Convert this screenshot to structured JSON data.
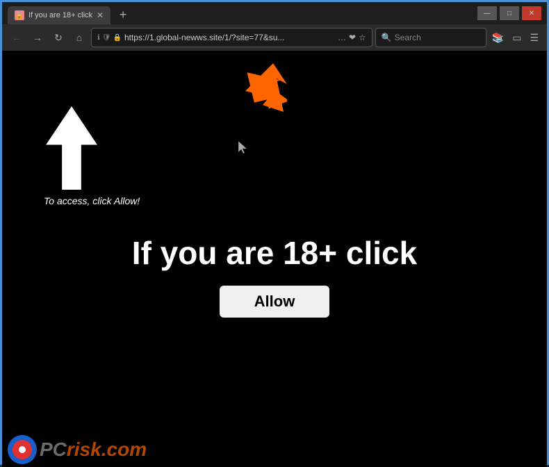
{
  "window": {
    "border_color": "#4a90d9"
  },
  "titlebar": {
    "tab": {
      "label": "If you are 18+ click",
      "favicon_text": "🔒"
    },
    "new_tab_label": "+",
    "controls": {
      "minimize": "—",
      "maximize": "□",
      "close": "✕"
    }
  },
  "navbar": {
    "back_icon": "←",
    "forward_icon": "→",
    "refresh_icon": "↻",
    "home_icon": "⌂",
    "address": {
      "url": "https://1.global-newws.site/1/?site=77&su...",
      "lock_icon": "🔒",
      "info_icon": "ℹ",
      "shield_icon": "🛡",
      "star_icon": "☆",
      "more_icon": "…"
    },
    "search": {
      "placeholder": "Search",
      "icon": "🔍"
    },
    "toolbar": {
      "library_icon": "📚",
      "sidebar_icon": "▭",
      "menu_icon": "☰"
    }
  },
  "page": {
    "headline": "If you are 18+ click",
    "access_text": "To access, click Allow!",
    "allow_button_label": "Allow"
  },
  "watermark": {
    "brand": "PC",
    "brand_colored": "risk",
    "domain": ".com"
  }
}
